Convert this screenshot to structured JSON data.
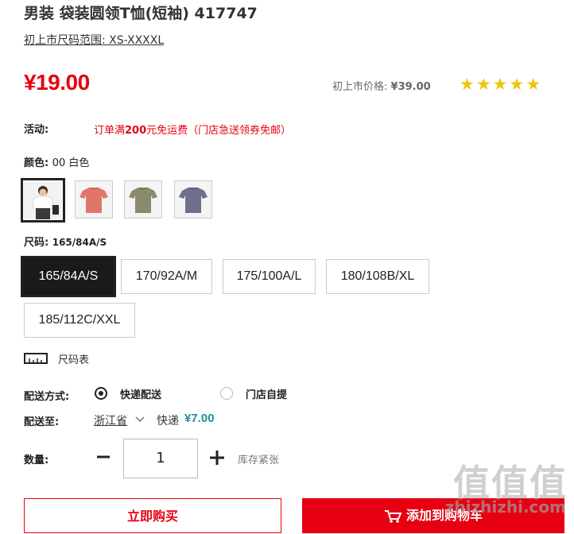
{
  "product": {
    "title": "男装 袋装圆领T恤(短袖) 417747",
    "size_range_link": "初上市尺码范围: XS-XXXXL",
    "price": "¥19.00",
    "original_price_label": "初上市价格:",
    "original_price": "¥39.00",
    "rating_stars": 5
  },
  "promotion": {
    "label": "活动:",
    "text_before": "订单满",
    "text_bold": "200",
    "text_after": "元免运费（门店急送领券免邮）"
  },
  "color": {
    "label": "颜色:",
    "selected": "00 白色",
    "swatches": [
      {
        "name": "白色",
        "color": "#ffffff"
      },
      {
        "name": "粉色",
        "color": "#e0766a"
      },
      {
        "name": "橄榄绿",
        "color": "#8a8a6c"
      },
      {
        "name": "灰蓝",
        "color": "#6e6f8a"
      }
    ]
  },
  "size": {
    "label": "尺码:",
    "selected": "165/84A/S",
    "options": [
      "165/84A/S",
      "170/92A/M",
      "175/100A/L",
      "180/108B/XL",
      "185/112C/XXL"
    ],
    "chart_link": "尺码表"
  },
  "delivery": {
    "method_label": "配送方式:",
    "method_express": "快递配送",
    "method_store": "门店自提",
    "to_label": "配送至:",
    "province": "浙江省",
    "carrier": "快递",
    "fee": "¥7.00"
  },
  "quantity": {
    "label": "数量:",
    "value": "1",
    "stock_note": "库存紧张"
  },
  "actions": {
    "buy_now": "立即购买",
    "add_to_cart": "添加到购物车"
  },
  "watermark": {
    "glyphs": "值值值",
    "url": "zhizhizhi.com"
  },
  "colors": {
    "accent": "#e60012",
    "star": "#f4c20d",
    "fee": "#2a8a9a"
  }
}
